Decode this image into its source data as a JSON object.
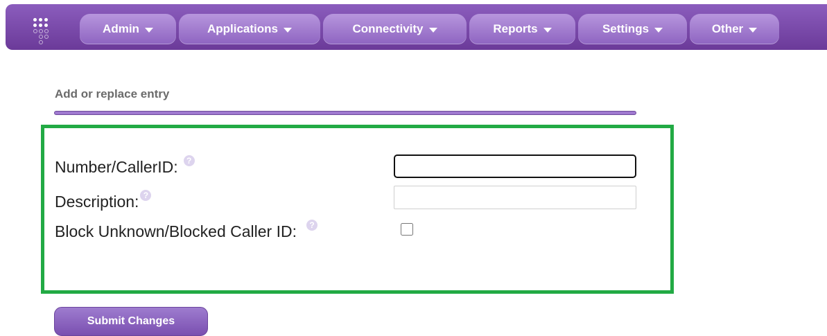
{
  "nav": {
    "logo_icon": "grid-dots-logo",
    "items": [
      {
        "label": "Admin"
      },
      {
        "label": "Applications"
      },
      {
        "label": "Connectivity"
      },
      {
        "label": "Reports"
      },
      {
        "label": "Settings"
      },
      {
        "label": "Other"
      }
    ]
  },
  "section": {
    "title": "Add or replace entry"
  },
  "form": {
    "number_label": "Number/CallerID:",
    "number_value": "",
    "description_label": "Description:",
    "description_value": "",
    "block_unknown_label": "Block Unknown/Blocked Caller ID:",
    "block_unknown_checked": false,
    "help_icon": "?"
  },
  "actions": {
    "submit_label": "Submit Changes"
  },
  "colors": {
    "nav_bg": "#7a4aa9",
    "accent": "#a07ad0",
    "highlight_box": "#22aa44"
  }
}
